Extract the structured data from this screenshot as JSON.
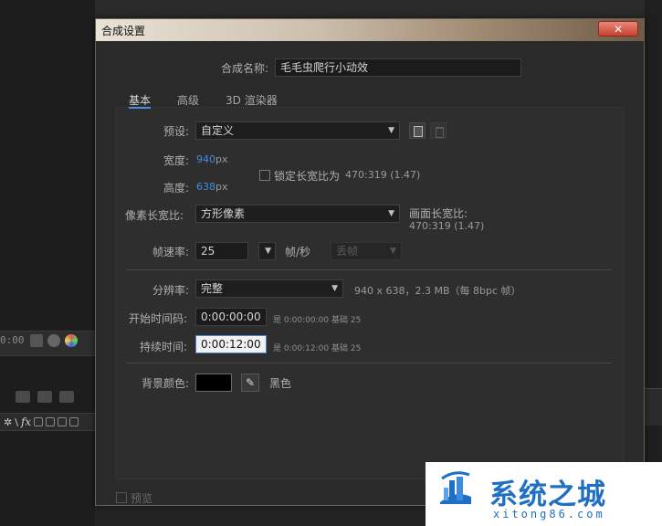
{
  "background": {
    "timecode": "0:00"
  },
  "dialog": {
    "title": "合成设置",
    "close_label": "✕",
    "comp_name_label": "合成名称:",
    "comp_name_value": "毛毛虫爬行小动效",
    "tabs": [
      {
        "label": "基本",
        "active": true
      },
      {
        "label": "高级",
        "active": false
      },
      {
        "label": "3D 渲染器",
        "active": false
      }
    ],
    "preset": {
      "label": "预设:",
      "value": "自定义"
    },
    "width": {
      "label": "宽度:",
      "value": "940",
      "unit": "px"
    },
    "height": {
      "label": "高度:",
      "value": "638",
      "unit": "px"
    },
    "lock_aspect": {
      "label": "锁定长宽比为",
      "ratio": "470:319 (1.47)",
      "checked": false
    },
    "pixel_aspect": {
      "label": "像素长宽比:",
      "value": "方形像素"
    },
    "frame_aspect": {
      "label": "画面长宽比:",
      "value": "470:319 (1.47)"
    },
    "frame_rate": {
      "label": "帧速率:",
      "value": "25",
      "unit": "帧/秒",
      "mode": "丢帧"
    },
    "resolution": {
      "label": "分辨率:",
      "value": "完整",
      "info": "940 x 638，2.3 MB（每 8bpc 帧）"
    },
    "start_timecode": {
      "label": "开始时间码:",
      "value": "0:00:00:00",
      "is_text": "是 0:00:00:00",
      "base_text": "基础 25"
    },
    "duration": {
      "label": "持续时间:",
      "value": "0:00:12:00",
      "is_text": "是 0:00:12:00",
      "base_text": "基础 25"
    },
    "bg_color": {
      "label": "背景颜色:",
      "name": "黑色",
      "hex": "#000000"
    },
    "preview": {
      "label": "预览"
    }
  },
  "watermark": {
    "brand": "系统之城",
    "url": "xitong86.com"
  }
}
